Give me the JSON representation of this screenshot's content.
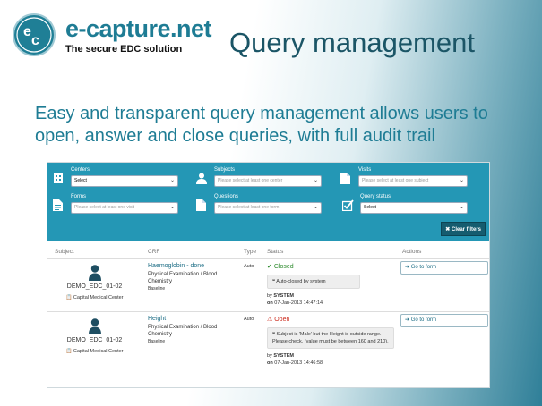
{
  "brand": {
    "name": "e-capture.net",
    "tagline": "The secure EDC solution",
    "logo_letters": "ec"
  },
  "hero": {
    "title": "Query management",
    "subtitle": "Easy and transparent query management allows users to open, answer and close queries, with full audit trail"
  },
  "filters": {
    "centers": {
      "label": "Centers",
      "value": "Select",
      "icon": "building-icon"
    },
    "subjects": {
      "label": "Subjects",
      "placeholder": "Please select at least one center",
      "icon": "user-icon"
    },
    "visits": {
      "label": "Visits",
      "placeholder": "Please select at least one subject",
      "icon": "document-icon"
    },
    "forms": {
      "label": "Forms",
      "placeholder": "Please select at least one visit",
      "icon": "form-icon"
    },
    "questions": {
      "label": "Questions",
      "placeholder": "Please select at least one form",
      "icon": "document-icon"
    },
    "query_status": {
      "label": "Query status",
      "value": "Select",
      "icon": "checkbox-icon"
    },
    "clear_label": "Clear filters"
  },
  "table": {
    "headers": {
      "subject": "Subject",
      "crf": "CRF",
      "type": "Type",
      "status": "Status",
      "actions": "Actions"
    },
    "rows": [
      {
        "subject_id": "DEMO_EDC_01-02",
        "center": "Capital Medical Center",
        "question": "Haemoglobin - done",
        "form": "Physical Examination / Blood Chemistry",
        "visit": "Baseline",
        "type": "Auto",
        "status": "Closed",
        "message": "Auto-closed by system",
        "by_label": "by",
        "by": "SYSTEM",
        "on_label": "on",
        "on": "07-Jan-2013 14:47:14",
        "action": "Go to form"
      },
      {
        "subject_id": "DEMO_EDC_01-02",
        "center": "Capital Medical Center",
        "question": "Height",
        "form": "Physical Examination / Blood Chemistry",
        "visit": "Baseline",
        "type": "Auto",
        "status": "Open",
        "message": "Subject is 'Male' but the Height is outside range. Please check. (value must be between 160 and 210).",
        "by_label": "by",
        "by": "SYSTEM",
        "on_label": "on",
        "on": "07-Jan-2013 14:46:58",
        "action": "Go to form"
      }
    ]
  },
  "colors": {
    "accent": "#2497b5",
    "dark": "#1b5566",
    "closed": "#2e8b2e",
    "open": "#cc2a1c"
  }
}
